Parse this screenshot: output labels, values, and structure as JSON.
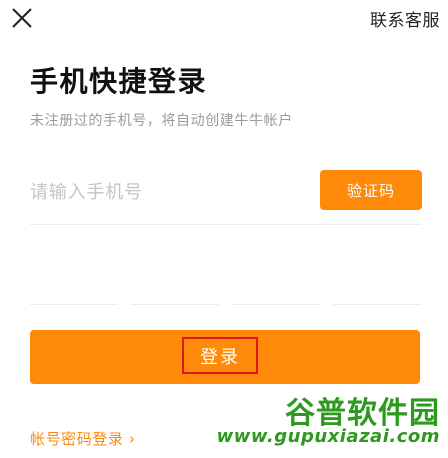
{
  "header": {
    "close_icon": "close-icon",
    "contact_label": "联系客服"
  },
  "main": {
    "title": "手机快捷登录",
    "subtitle": "未注册过的手机号，将自动创建牛牛帐户",
    "phone_input": {
      "placeholder": "请输入手机号",
      "value": ""
    },
    "verify_button_label": "验证码",
    "code_boxes": [
      "",
      "",
      "",
      ""
    ],
    "login_button_label": "登录",
    "password_login_label": "帐号密码登录 ›"
  },
  "watermark": {
    "title": "谷普软件园",
    "url": "www.gupuxiazai.com"
  },
  "colors": {
    "accent": "#ff8a0a",
    "highlight_border": "#e0141b",
    "watermark_green": "#2d9a1e"
  }
}
